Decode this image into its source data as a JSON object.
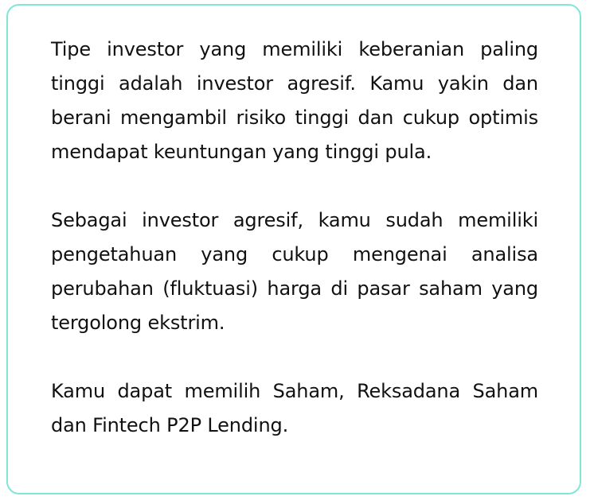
{
  "paragraphs": [
    "Tipe investor yang memiliki keberanian paling tinggi adalah investor agresif. Kamu yakin dan berani mengambil risiko tinggi dan cukup optimis mendapat keuntungan yang tinggi pula.",
    "Sebagai investor agresif, kamu sudah memiliki pengetahuan yang  cukup mengenai analisa perubahan (fluktuasi) harga di pasar saham yang tergolong ekstrim.",
    "Kamu dapat memilih Saham, Reksadana Saham dan Fintech P2P Lending."
  ],
  "colors": {
    "border": "#7fe6d8",
    "text": "#111111",
    "background": "#ffffff"
  }
}
